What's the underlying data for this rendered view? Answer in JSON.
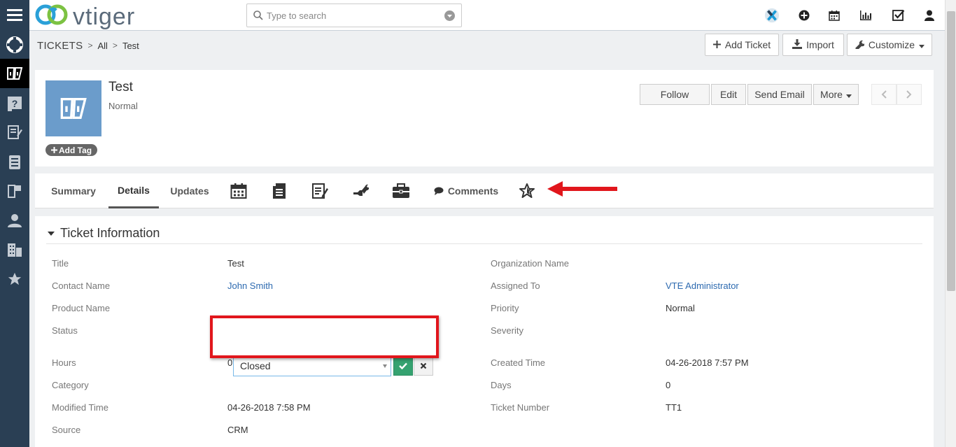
{
  "app": {
    "logo_text": "vtiger",
    "colors": {
      "rail": "#2a3f54",
      "accent_link": "#2d6ab0",
      "confirm_green": "#35a270",
      "annotation_red": "#e1161c",
      "record_image": "#6b9ccb"
    }
  },
  "rail": {
    "items": [
      {
        "icon": "menu-icon"
      },
      {
        "icon": "lifebuoy-icon"
      },
      {
        "icon": "tickets-icon",
        "active": true
      },
      {
        "icon": "faq-icon"
      },
      {
        "icon": "edit-list-icon"
      },
      {
        "icon": "server-icon"
      },
      {
        "icon": "service-contracts-icon"
      },
      {
        "icon": "contacts-icon"
      },
      {
        "icon": "organizations-icon"
      },
      {
        "icon": "star-icon"
      }
    ]
  },
  "search": {
    "placeholder": "Type to search",
    "value": ""
  },
  "header_icons": [
    "vtiger-x-icon",
    "add-circle-icon",
    "calendar-icon",
    "reports-icon",
    "tasks-check-icon",
    "user-icon"
  ],
  "breadcrumb": {
    "module": "TICKETS",
    "filter": "All",
    "record": "Test"
  },
  "toolbar": {
    "add_ticket": "Add Ticket",
    "import": "Import",
    "customize": "Customize"
  },
  "record": {
    "title": "Test",
    "subtitle": "Normal",
    "add_tag": "Add Tag",
    "actions": {
      "follow": "Follow",
      "edit": "Edit",
      "send_email": "Send Email",
      "more": "More"
    }
  },
  "tabs": {
    "summary": "Summary",
    "details": "Details",
    "updates": "Updates",
    "comments": "Comments",
    "icons": [
      "calendar-icon",
      "document-icon",
      "notes-icon",
      "tools-icon",
      "briefcase-icon",
      "comment-icon",
      "star-icon"
    ]
  },
  "block": {
    "title": "Ticket Information",
    "left": [
      {
        "label": "Title",
        "value": "Test"
      },
      {
        "label": "Contact Name",
        "value": "John Smith"
      },
      {
        "label": "Product Name",
        "value": ""
      },
      {
        "label": "Status",
        "value": "Closed"
      },
      {
        "label": "Hours",
        "value": "0"
      },
      {
        "label": "Category",
        "value": ""
      },
      {
        "label": "Modified Time",
        "value": "04-26-2018 7:58 PM"
      },
      {
        "label": "Source",
        "value": "CRM"
      }
    ],
    "right": [
      {
        "label": "Organization Name",
        "value": ""
      },
      {
        "label": "Assigned To",
        "value": "VTE Administrator"
      },
      {
        "label": "Priority",
        "value": "Normal"
      },
      {
        "label": "Severity",
        "value": ""
      },
      {
        "label": "Created Time",
        "value": "04-26-2018 7:57 PM"
      },
      {
        "label": "Days",
        "value": "0"
      },
      {
        "label": "Ticket Number",
        "value": "TT1"
      }
    ]
  }
}
